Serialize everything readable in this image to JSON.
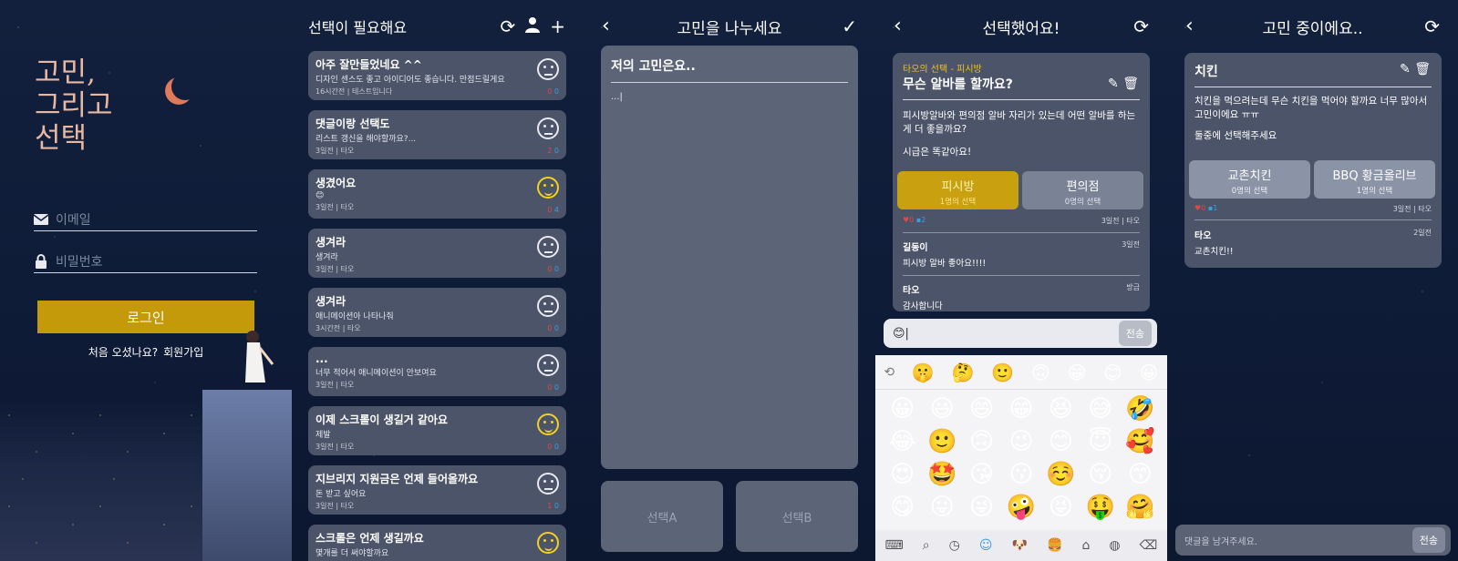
{
  "login": {
    "brand": [
      "고민,",
      "그리고",
      "선택"
    ],
    "email_placeholder": "이메일",
    "password_placeholder": "비밀번호",
    "login_button": "로그인",
    "signup_prompt": "처음 오셨나요?",
    "signup_link": "회원가입"
  },
  "list": {
    "title": "선택이 필요해요",
    "items": [
      {
        "title": "아주 잘만들었네요 ^^",
        "snippet": "디자인 센스도 좋고 아이디어도 좋습니다. 만점드릴게요",
        "meta": "16시간전 | 테스트입니다",
        "dislikes": "0",
        "likes": "0",
        "face": "neutral"
      },
      {
        "title": "댓글이랑 선택도",
        "snippet": "리스트 갱신을 해야할까요?...",
        "meta": "3일전 | 타오",
        "dislikes": "2",
        "likes": "0",
        "face": "neutral"
      },
      {
        "title": "생겼어요",
        "snippet": "😊",
        "meta": "3일전 | 타오",
        "dislikes": "0",
        "likes": "4",
        "face": "happy"
      },
      {
        "title": "생겨라",
        "snippet": "생겨라",
        "meta": "3일전 | 타오",
        "dislikes": "0",
        "likes": "0",
        "face": "neutral"
      },
      {
        "title": "생겨라",
        "snippet": "애니메이션아 나타나줘",
        "meta": "3시간전 | 타오",
        "dislikes": "0",
        "likes": "0",
        "face": "neutral"
      },
      {
        "title": "...",
        "snippet": "너무 적어서 애니메이션이 안보여요",
        "meta": "3일전 | 타오",
        "dislikes": "0",
        "likes": "0",
        "face": "neutral"
      },
      {
        "title": "이제 스크롤이 생길거 같아요",
        "snippet": "제발",
        "meta": "3일전 | 타오",
        "dislikes": "0",
        "likes": "0",
        "face": "happy"
      },
      {
        "title": "지브리지 지원금은 언제 들어올까요",
        "snippet": "돈 받고 싶어요",
        "meta": "3일전 | 타오",
        "dislikes": "1",
        "likes": "0",
        "face": "neutral"
      },
      {
        "title": "스크롤은 언제 생길까요",
        "snippet": "몇개를 더 써야할까요",
        "meta": "",
        "dislikes": "",
        "likes": "",
        "face": "happy"
      }
    ]
  },
  "write": {
    "title": "고민을 나누세요",
    "heading": "저의 고민은요..",
    "body": "...|",
    "choice_a": "선택A",
    "choice_b": "선택B"
  },
  "detail": {
    "title": "선택했어요!",
    "tag": "타오의 선택 - 피시방",
    "question": "무슨 알바를 할까요?",
    "body": [
      "피시방알바와 편의점 알바 자리가 있는데 어떤 알바를 하는게 더 좋을까요?",
      "시급은 똑같아요!"
    ],
    "options": [
      {
        "name": "피시방",
        "count": "1명의 선택"
      },
      {
        "name": "편의점",
        "count": "0명의 선택"
      }
    ],
    "dislikes": "0",
    "likes": "2",
    "meta": "3일전 | 타오",
    "comments": [
      {
        "who": "길동이",
        "when": "3일전",
        "text": "피시방 알바 좋아요!!!!"
      },
      {
        "who": "타오",
        "when": "방금",
        "text": "감사합니다"
      }
    ],
    "input_value": "😊|",
    "send": "전송",
    "emoji_top": [
      "🤫",
      "🤔",
      "🙂",
      "🙃",
      "😁",
      "😊",
      "😀"
    ],
    "emoji_grid": [
      "😀",
      "😃",
      "😄",
      "😁",
      "😆",
      "😅",
      "🤣",
      "😂",
      "🙂",
      "🙃",
      "😉",
      "😊",
      "😇",
      "🥰",
      "😍",
      "🤩",
      "😘",
      "😗",
      "☺️",
      "😚",
      "😙",
      "😋",
      "😛",
      "😜",
      "🤪",
      "😝",
      "🤑",
      "🤗"
    ]
  },
  "pending": {
    "title": "고민 중이에요..",
    "question": "치킨",
    "body": [
      "치킨을 먹으려는데 무슨 치킨을 먹어야 할까요 너무 많아서 고민이에요 ㅠㅠ",
      "둘중에 선택해주세요"
    ],
    "options": [
      {
        "name": "교촌치킨",
        "count": "0명의 선택"
      },
      {
        "name": "BBQ 황금올리브",
        "count": "1명의 선택"
      }
    ],
    "dislikes": "0",
    "likes": "1",
    "meta": "3일전 | 타오",
    "comments": [
      {
        "who": "타오",
        "when": "2일전",
        "text": "교촌치킨!!"
      }
    ],
    "comment_placeholder": "댓글을 남겨주세요.",
    "send": "전송"
  },
  "colors": {
    "accent": "#c49a0a",
    "card": "#4b5468",
    "like": "#3a9de0",
    "dislike": "#e04848"
  }
}
